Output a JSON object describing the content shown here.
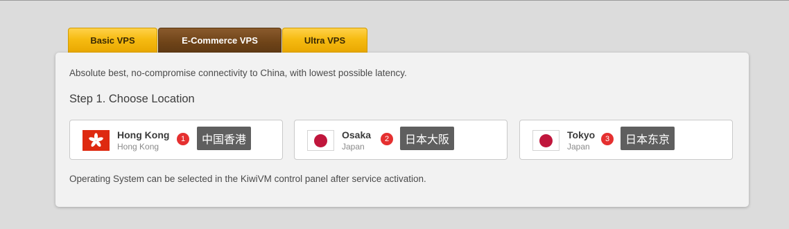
{
  "tabs": [
    {
      "label": "Basic VPS",
      "active": false
    },
    {
      "label": "E-Commerce VPS",
      "active": true
    },
    {
      "label": "Ultra VPS",
      "active": false
    }
  ],
  "panel": {
    "description": "Absolute best, no-compromise connectivity to China, with lowest possible latency.",
    "step_title": "Step 1. Choose Location",
    "note": "Operating System can be selected in the KiwiVM control panel after service activation."
  },
  "locations": [
    {
      "city": "Hong Kong",
      "country": "Hong Kong",
      "flag": "hong-kong-flag-icon",
      "badge": "1",
      "tooltip": "中国香港"
    },
    {
      "city": "Osaka",
      "country": "Japan",
      "flag": "japan-flag-icon",
      "badge": "2",
      "tooltip": "日本大阪"
    },
    {
      "city": "Tokyo",
      "country": "Japan",
      "flag": "japan-flag-icon",
      "badge": "3",
      "tooltip": "日本东京"
    }
  ],
  "colors": {
    "tab_gold": "#f6bb12",
    "tab_active_brown": "#6e4318",
    "badge_red": "#e53030",
    "tooltip_gray": "#5f5f5f"
  }
}
